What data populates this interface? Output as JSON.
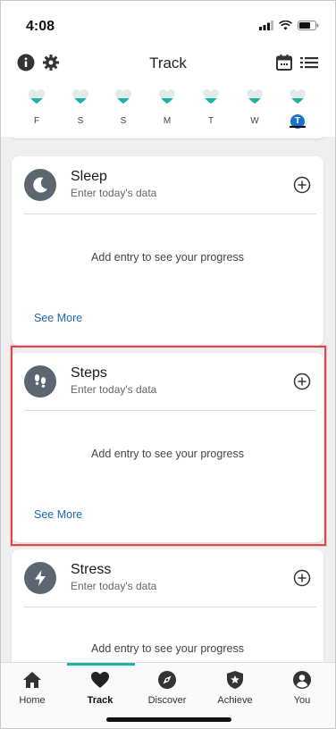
{
  "status_bar": {
    "time": "4:08"
  },
  "header": {
    "title": "Track"
  },
  "days": [
    {
      "label": "F",
      "selected": false
    },
    {
      "label": "S",
      "selected": false
    },
    {
      "label": "S",
      "selected": false
    },
    {
      "label": "M",
      "selected": false
    },
    {
      "label": "T",
      "selected": false
    },
    {
      "label": "W",
      "selected": false
    },
    {
      "label": "T",
      "selected": true
    }
  ],
  "cards": [
    {
      "title": "Sleep",
      "subtitle": "Enter today's data",
      "empty_text": "Add entry to see your progress",
      "more_label": "See More",
      "icon": "moon-icon"
    },
    {
      "title": "Steps",
      "subtitle": "Enter today's data",
      "empty_text": "Add entry to see your progress",
      "more_label": "See More",
      "icon": "footprints-icon"
    },
    {
      "title": "Stress",
      "subtitle": "Enter today's data",
      "empty_text": "Add entry to see your progress",
      "icon": "lightning-icon"
    }
  ],
  "nav": {
    "items": [
      {
        "label": "Home",
        "icon": "home-icon",
        "active": false
      },
      {
        "label": "Track",
        "icon": "heart-icon",
        "active": true
      },
      {
        "label": "Discover",
        "icon": "compass-icon",
        "active": false
      },
      {
        "label": "Achieve",
        "icon": "shield-star-icon",
        "active": false
      },
      {
        "label": "You",
        "icon": "person-icon",
        "active": false
      }
    ]
  },
  "colors": {
    "accent": "#19b3a6",
    "link": "#1a66b3",
    "selected_day": "#1a73c9",
    "highlight": "#e0474c",
    "icon_bg": "#5b6670"
  }
}
